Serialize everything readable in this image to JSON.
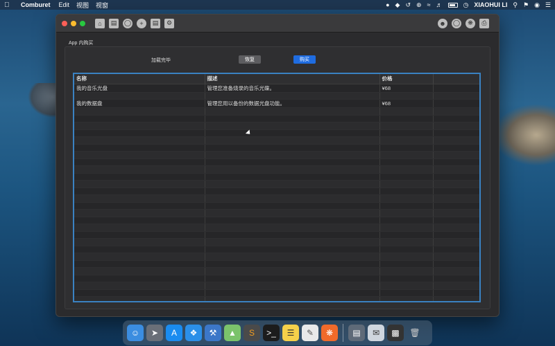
{
  "menubar": {
    "app_name": "Comburet",
    "menus": [
      "Edit",
      "视图",
      "视窗"
    ],
    "user": "XIAOHUI LI"
  },
  "window": {
    "section_label": "App 内购买",
    "status": "加载完毕",
    "restore_label": "恢复",
    "buy_label": "购买",
    "table": {
      "headers": [
        "名称",
        "描述",
        "价格",
        ""
      ],
      "rows": [
        [
          "我的音乐光盘",
          "管理您准备烧录的音乐光碟。",
          "¥68",
          ""
        ],
        [
          "",
          "",
          "",
          ""
        ],
        [
          "我的数据盘",
          "管理您用以备份的数据光盘功能。",
          "¥68",
          ""
        ]
      ]
    }
  },
  "colors": {
    "accent": "#1f6ce0",
    "table_border": "#3a82c2"
  },
  "icons": {
    "toolbar_left": [
      "home-icon",
      "document-icon",
      "disc-icon",
      "disc-add-icon",
      "file-icon",
      "file-settings-icon"
    ],
    "toolbar_right": [
      "user-icon",
      "disc-icon",
      "disc-burn-icon",
      "printer-icon"
    ]
  }
}
